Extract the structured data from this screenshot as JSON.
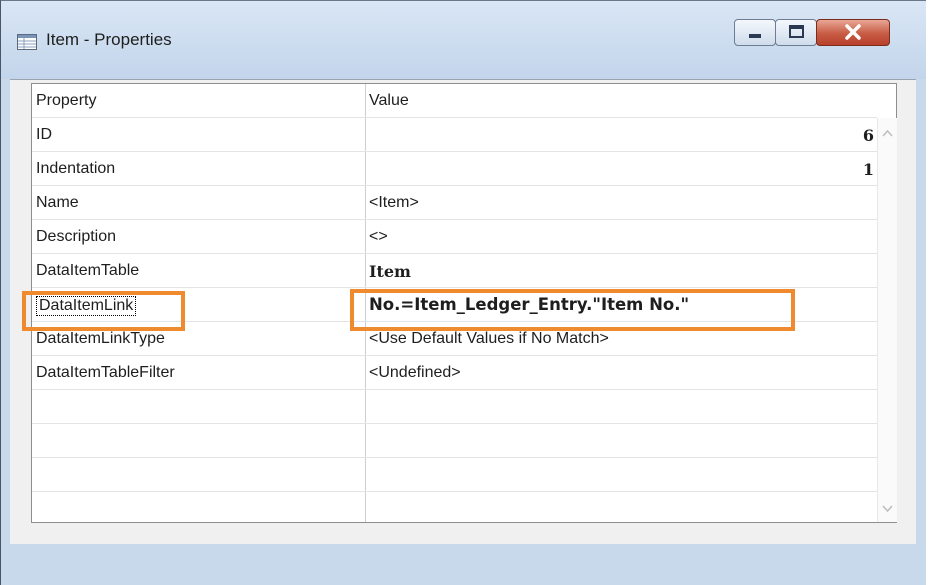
{
  "window": {
    "title": "Item - Properties",
    "buttons": {
      "minimize": "minimize-icon",
      "maximize": "maximize-icon",
      "close": "close-icon"
    }
  },
  "grid": {
    "headers": {
      "property": "Property",
      "value": "Value"
    },
    "rows": [
      {
        "property": "ID",
        "value": "6"
      },
      {
        "property": "Indentation",
        "value": "1"
      },
      {
        "property": "Name",
        "value": "<Item>"
      },
      {
        "property": "Description",
        "value": "<>"
      },
      {
        "property": "DataItemTable",
        "value": "Item"
      },
      {
        "property": "DataItemLink",
        "value": "No.=Item_Ledger_Entry.\"Item No.\""
      },
      {
        "property": "DataItemLinkType",
        "value": "<Use Default Values if No Match>"
      },
      {
        "property": "DataItemTableFilter",
        "value": "<Undefined>"
      }
    ]
  },
  "colors": {
    "highlight": "#ef8a2e",
    "close_button": "#c75b44"
  }
}
